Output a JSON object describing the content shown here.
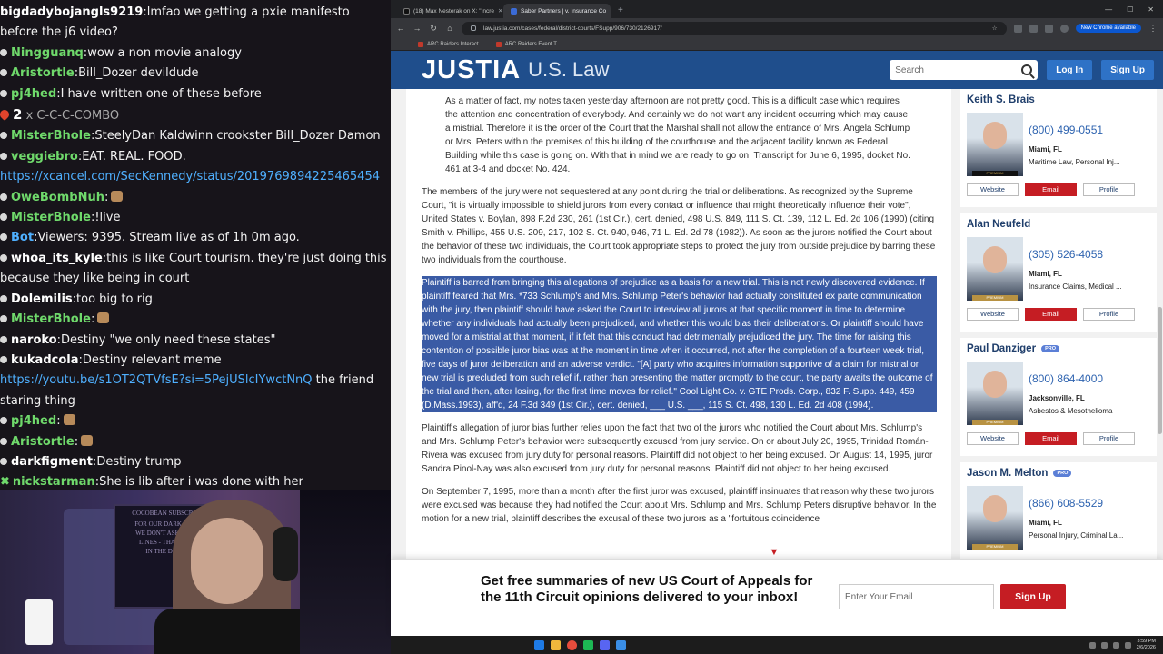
{
  "chat": {
    "lines": [
      {
        "user": "bigdadybojangls9219",
        "user_color": "#ffffff",
        "text": "lmfao we getting a pxie manifesto before the j6 video?",
        "badge": "none"
      },
      {
        "user": "Ningguanq",
        "user_color": "#6fd96b",
        "text": "wow a non movie analogy",
        "badge": "dot"
      },
      {
        "user": "Aristortle",
        "user_color": "#6fd96b",
        "text": "Bill_Dozer devildude",
        "badge": "dot"
      },
      {
        "user": "pj4hed",
        "user_color": "#6fd96b",
        "text": "I have written one of these before",
        "badge": "dot"
      },
      {
        "combo": true,
        "count": "2",
        "text": "x C-C-C-COMBO"
      },
      {
        "user": "MisterBhole",
        "user_color": "#6fd96b",
        "text": "SteelyDan Kaldwinn crookster Bill_Dozer Damon",
        "badge": "dot"
      },
      {
        "user": "veggiebro",
        "user_color": "#6fd96b",
        "text": "EAT. REAL. FOOD.",
        "badge": "dot"
      },
      {
        "link": "https://xcancel.com/SecKennedy/status/2019769894225465454"
      },
      {
        "user": "OweBombNuh",
        "user_color": "#6fd96b",
        "text": "",
        "badge": "dot"
      },
      {
        "user": "MisterBhole",
        "user_color": "#6fd96b",
        "text": "!live",
        "badge": "dot"
      },
      {
        "user": "Bot",
        "user_color": "#4fb0ff",
        "text": "Viewers: 9395. Stream live as of 1h 0m ago.",
        "badge": "dot"
      },
      {
        "user": "whoa_its_kyle",
        "user_color": "#ffffff",
        "text": "this is like Court tourism. they're just doing this because they like being in court",
        "badge": "dot"
      },
      {
        "user": "Dolemilis",
        "user_color": "#ffffff",
        "text": "too big to rig",
        "badge": "dot"
      },
      {
        "user": "MisterBhole",
        "user_color": "#6fd96b",
        "text": "",
        "badge": "dot"
      },
      {
        "user": "naroko",
        "user_color": "#ffffff",
        "text": "Destiny \"we only need these states\"",
        "badge": "dot"
      },
      {
        "user": "kukadcola",
        "user_color": "#ffffff",
        "text": "Destiny relevant meme",
        "badge": "dot"
      },
      {
        "link": "https://youtu.be/s1OT2QTVfsE?si=5PejUSlcIYwctNnQ",
        "after": "the friend staring thing"
      },
      {
        "user": "pj4hed",
        "user_color": "#6fd96b",
        "text": "",
        "badge": "dot"
      },
      {
        "user": "Aristortle",
        "user_color": "#6fd96b",
        "text": "",
        "badge": "dot"
      },
      {
        "user": "darkfigment",
        "user_color": "#ffffff",
        "text": "Destiny trump",
        "badge": "dot"
      },
      {
        "user": "nickstarman",
        "user_color": "#6fd96b",
        "text": "She is lib after i was done with her",
        "badge": "cross"
      }
    ]
  },
  "webcam": {
    "poster_lines": [
      "COCOBEAN SUBSCRI",
      "FOR OUR DARK KN",
      "WE DON'T ASK WH",
      "LINES - THANKS",
      "IN THE DAR"
    ]
  },
  "browser": {
    "tabs": [
      {
        "label": "(18) Max Nesterak on X: \"Incre",
        "fav": "#111111",
        "active": false
      },
      {
        "label": "Saber Partners | v. Insurance Co",
        "fav": "#3b6bd6",
        "active": true
      }
    ],
    "url": "law.justia.com/cases/federal/district-courts/FSupp/906/730/2126917/",
    "new_chrome": "New Chrome available",
    "bookmarks": [
      "ARC Raiders Interact...",
      "ARC Raiders Event T..."
    ]
  },
  "justia": {
    "logo_main": "JUSTIA",
    "logo_sub": "U.S. Law",
    "search_placeholder": "Search",
    "login": "Log In",
    "signup": "Sign Up"
  },
  "article": {
    "quote": "As a matter of fact, my notes taken yesterday afternoon are not pretty good. This is a difficult case which requires the attention and concentration of everybody. And certainly we do not want any incident occurring which may cause a mistrial. Therefore it is the order of the Court that the Marshal shall not allow the entrance of Mrs. Angela Schlump or Mrs. Peters within the premises of this building of the courthouse and the adjacent facility known as Federal Building while this case is going on. With that in mind we are ready to go on. Transcript for June 6, 1995, docket No. 461 at 3-4 and docket No. 424.",
    "p1": "The members of the jury were not sequestered at any point during the trial or deliberations. As recognized by the Supreme Court, \"it is virtually impossible to shield jurors from every contact or influence that might theoretically influence their vote\", United States v. Boylan, 898 F.2d 230, 261 (1st Cir.), cert. denied, 498 U.S. 849, 111 S. Ct. 139, 112 L. Ed. 2d 106 (1990) (citing Smith v. Phillips, 455 U.S. 209, 217, 102 S. Ct. 940, 946, 71 L. Ed. 2d 78 (1982)). As soon as the jurors notified the Court about the behavior of these two individuals, the Court took appropriate steps to protect the jury from outside prejudice by barring these two individuals from the courthouse.",
    "p2": "Plaintiff is barred from bringing this allegations of prejudice as a basis for a new trial. This is not newly discovered evidence. If plaintiff feared that Mrs. *733 Schlump's and Mrs. Schlump Peter's behavior had actually constituted ex parte communication with the jury, then plaintiff should have asked the Court to interview all jurors at that specific moment in time to determine whether any individuals had actually been prejudiced, and whether this would bias their deliberations. Or plaintiff should have moved for a mistrial at that moment, if it felt that this conduct had detrimentally prejudiced the jury. The time for raising this contention of possible juror bias was at the moment in time when it occurred, not after the completion of a fourteen week trial, five days of juror deliberation and an adverse verdict. \"[A] party who acquires information supportive of a claim for mistrial or new trial is precluded from such relief if, rather than presenting the matter promptly to the court, the party awaits the outcome of the trial and then, after losing, for the first time moves for relief.\" Cool Light Co. v. GTE Prods. Corp., 832 F. Supp. 449, 459 (D.Mass.1993), aff'd, 24 F.3d 349 (1st Cir.), cert. denied, ___ U.S. ___, 115 S. Ct. 498, 130 L. Ed. 2d 408 (1994).",
    "p3": "Plaintiff's allegation of juror bias further relies upon the fact that two of the jurors who notified the Court about Mrs. Schlump's and Mrs. Schlump Peter's behavior were subsequently excused from jury service. On or about July 20, 1995, Trinidad Román-Rivera was excused from jury duty for personal reasons. Plaintiff did not object to her being excused. On August 14, 1995, juror Sandra Pinol-Nay was also excused from jury duty for personal reasons. Plaintiff did not object to her being excused.",
    "p4": "On September 7, 1995, more than a month after the first juror was excused, plaintiff insinuates that reason why these two jurors were excused was because they had notified the Court about Mrs. Schlump and Mrs. Schlump Peters disruptive behavior. In the motion for a new trial, plaintiff describes the excusal of these two jurors as a \"fortuitous coincidence"
  },
  "lawyers": [
    {
      "name": "Keith S. Brais",
      "pro": "",
      "phone": "(800) 499-0551",
      "city": "Miami, FL",
      "areas": "Maritime Law, Personal Inj...",
      "badge": "PREMIUM",
      "badge_style": "dark"
    },
    {
      "name": "Alan Neufeld",
      "pro": "",
      "phone": "(305) 526-4058",
      "city": "Miami, FL",
      "areas": "Insurance Claims, Medical ...",
      "badge": "PREMIUM",
      "badge_style": "gold"
    },
    {
      "name": "Paul Danziger",
      "pro": "PRO",
      "phone": "(800) 864-4000",
      "city": "Jacksonville, FL",
      "areas": "Asbestos & Mesothelioma",
      "badge": "PREMIUM",
      "badge_style": "gold"
    },
    {
      "name": "Jason M. Melton",
      "pro": "PRO",
      "phone": "(866) 608-5529",
      "city": "Miami, FL",
      "areas": "Personal Injury, Criminal La...",
      "badge": "PREMIUM",
      "badge_style": "gold"
    }
  ],
  "lawyer_buttons": {
    "website": "Website",
    "email": "Email",
    "profile": "Profile"
  },
  "banner": {
    "title": "Get free summaries of new US Court of Appeals for the 11th Circuit opinions delivered to your inbox!",
    "email_placeholder": "Enter Your Email",
    "signup": "Sign Up"
  },
  "taskbar": {
    "time": "3:59 PM",
    "date": "2/6/2026",
    "icon_colors": [
      "#1e7be6",
      "#f0b73c",
      "#e74c3c",
      "#1db954",
      "#5865f2",
      "#3a8ee6"
    ]
  }
}
